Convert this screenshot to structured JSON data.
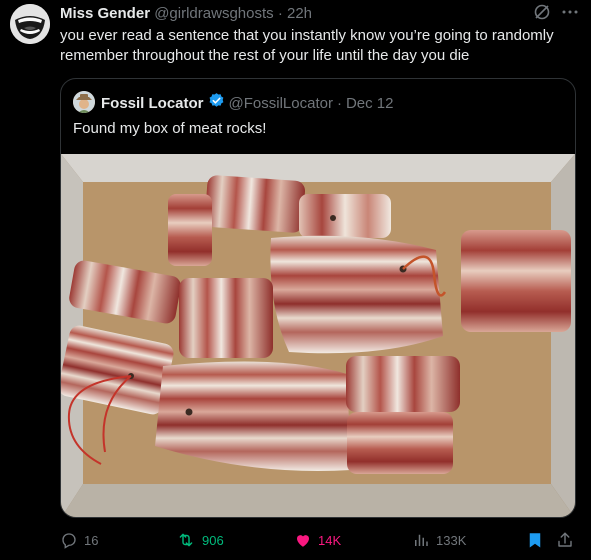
{
  "author": {
    "name": "Miss Gender",
    "handle": "@girldrawsghosts",
    "separator": "·",
    "time": "22h",
    "avatar_icon": "laughing-mouth-avatar"
  },
  "tweet_text": "you ever read a sentence that you instantly know you’re going to randomly remember throughout the rest of your life until the day you die",
  "quote": {
    "name": "Fossil Locator",
    "handle": "@FossilLocator",
    "separator": "·",
    "date": "Dec 12",
    "verified": true,
    "text": "Found my box of meat rocks!",
    "image_icon": "photo-meat-rocks-in-box"
  },
  "actions": {
    "replies": "16",
    "retweets": "906",
    "likes": "14K",
    "views": "133K"
  },
  "colors": {
    "background": "#000000",
    "text": "#e7e9ea",
    "muted": "#71767b",
    "retweet": "#00ba7c",
    "like": "#f91880",
    "accent": "#1d9bf0",
    "border": "#2f3336"
  }
}
